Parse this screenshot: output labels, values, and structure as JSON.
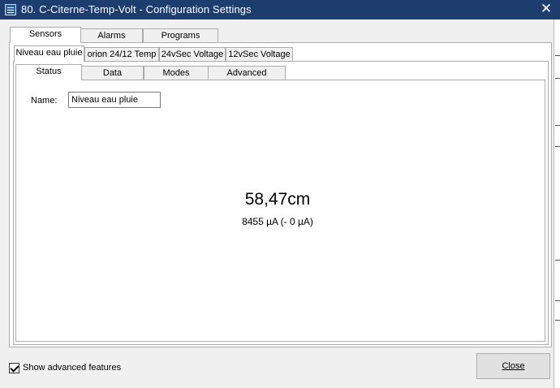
{
  "window": {
    "title": "80. C-Citerne-Temp-Volt - Configuration Settings",
    "close_glyph": "✕",
    "icon": "app-icon"
  },
  "top_tabs": [
    {
      "label": "Sensors",
      "active": true
    },
    {
      "label": "Alarms",
      "active": false
    },
    {
      "label": "Programs",
      "active": false
    }
  ],
  "sensor_tabs": [
    {
      "label": "Niveau eau pluie",
      "active": true
    },
    {
      "label": "orion 24/12 Temp",
      "active": false
    },
    {
      "label": "24vSec Voltage",
      "active": false
    },
    {
      "label": "12vSec Voltage",
      "active": false
    }
  ],
  "detail_tabs": [
    {
      "label": "Status",
      "active": true
    },
    {
      "label": "Data",
      "active": false
    },
    {
      "label": "Modes",
      "active": false
    },
    {
      "label": "Advanced",
      "active": false
    }
  ],
  "status": {
    "name_label": "Name:",
    "name_value": "Niveau eau pluie",
    "reading": "58,47cm",
    "current": "8455 µA (- 0 µA)"
  },
  "footer": {
    "advanced_label": "Show advanced features",
    "advanced_checked": true,
    "close_label": "Close"
  },
  "colors": {
    "titlebar": "#1c3d6e",
    "background": "#f0f0f0",
    "panel": "#ffffff"
  }
}
